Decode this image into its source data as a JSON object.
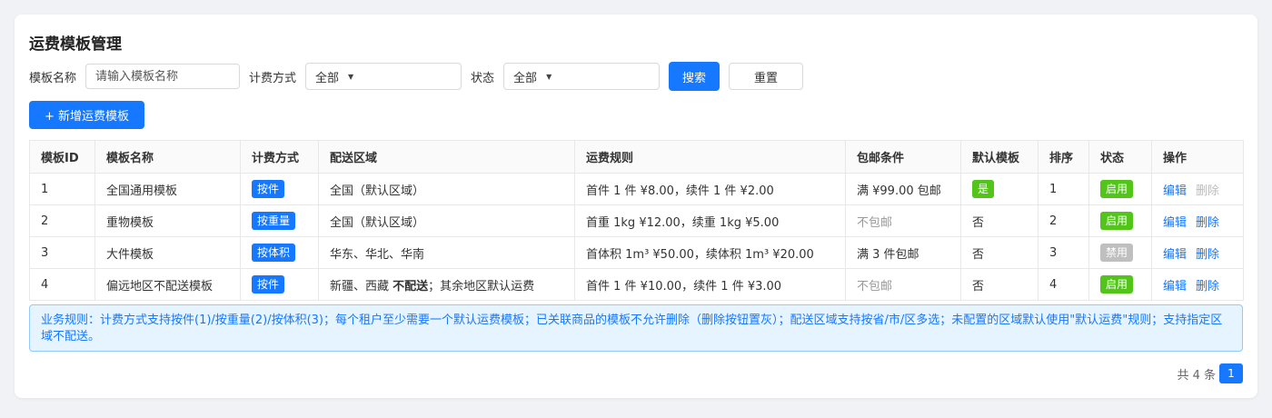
{
  "page": {
    "title": "运费模板管理"
  },
  "filters": {
    "name_label": "模板名称",
    "name_placeholder": "请输入模板名称",
    "method_label": "计费方式",
    "method_value": "全部",
    "status_label": "状态",
    "status_value": "全部",
    "search_label": "搜索",
    "reset_label": "重置"
  },
  "actions": {
    "add_label": "+ 新增运费模板"
  },
  "table": {
    "headers": [
      "模板ID",
      "模板名称",
      "计费方式",
      "配送区域",
      "运费规则",
      "包邮条件",
      "默认模板",
      "排序",
      "状态",
      "操作"
    ],
    "rows": [
      {
        "id": "1",
        "name": "全国通用模板",
        "method": "按件",
        "region": "全国（默认区域）",
        "region_extra": "",
        "region_rest": "",
        "rule": "首件 1 件 ¥8.00，续件 1 件 ¥2.00",
        "free": "满 ¥99.00 包邮",
        "default": "是",
        "sort": "1",
        "status": "启用",
        "edit": "编辑",
        "delete": "删除"
      },
      {
        "id": "2",
        "name": "重物模板",
        "method": "按重量",
        "region": "全国（默认区域）",
        "region_extra": "",
        "region_rest": "",
        "rule": "首重 1kg ¥12.00，续重 1kg ¥5.00",
        "free": "不包邮",
        "default": "否",
        "sort": "2",
        "status": "启用",
        "edit": "编辑",
        "delete": "删除"
      },
      {
        "id": "3",
        "name": "大件模板",
        "method": "按体积",
        "region": "华东、华北、华南",
        "region_extra": "",
        "region_rest": "",
        "rule": "首体积 1m³ ¥50.00，续体积 1m³ ¥20.00",
        "free": "满 3 件包邮",
        "default": "否",
        "sort": "3",
        "status": "禁用",
        "edit": "编辑",
        "delete": "删除"
      },
      {
        "id": "4",
        "name": "偏远地区不配送模板",
        "method": "按件",
        "region": "新疆、西藏 ",
        "region_extra": "不配送",
        "region_rest": "；其余地区默认运费",
        "rule": "首件 1 件 ¥10.00，续件 1 件 ¥3.00",
        "free": "不包邮",
        "default": "否",
        "sort": "4",
        "status": "启用",
        "edit": "编辑",
        "delete": "删除"
      }
    ]
  },
  "notice": "业务规则：计费方式支持按件(1)/按重量(2)/按体积(3)；每个租户至少需要一个默认运费模板；已关联商品的模板不允许删除（删除按钮置灰）；配送区域支持按省/市/区多选；未配置的区域默认使用\"默认运费\"规则；支持指定区域不配送。",
  "pagination": {
    "total_text": "共 4 条",
    "current_page": "1"
  },
  "colors": {
    "primary": "#1677ff",
    "success": "#52c41a",
    "disabled": "#bfbfbf"
  }
}
